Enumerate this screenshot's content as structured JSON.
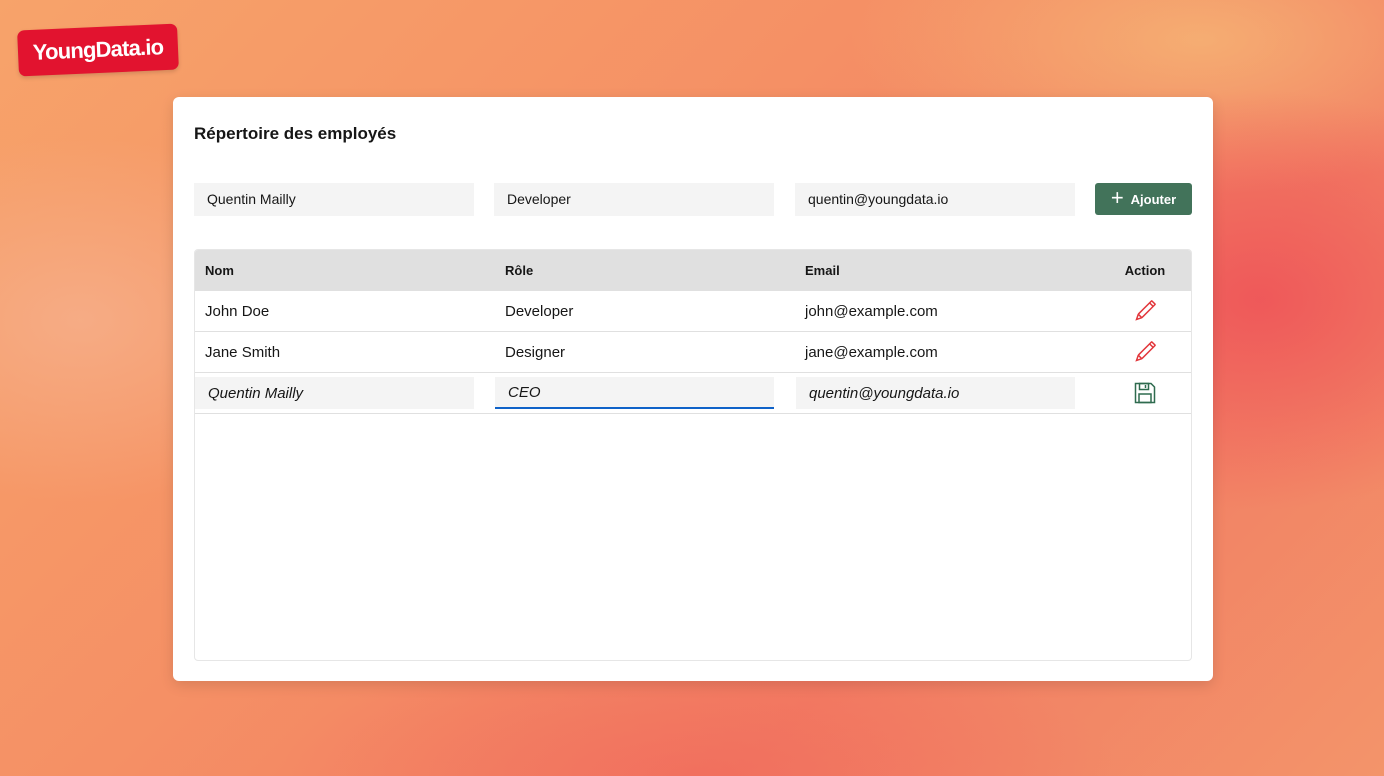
{
  "brand": {
    "logo_text": "YoungData.io",
    "color": "#e2132f"
  },
  "card": {
    "title": "Répertoire des employés"
  },
  "form": {
    "name_value": "Quentin Mailly",
    "role_value": "Developer",
    "email_value": "quentin@youngdata.io",
    "add_label": "Ajouter",
    "add_color": "#42735a"
  },
  "table": {
    "headers": {
      "name": "Nom",
      "role": "Rôle",
      "email": "Email",
      "action": "Action"
    },
    "rows": [
      {
        "name": "John Doe",
        "role": "Developer",
        "email": "john@example.com",
        "action_icon": "pencil-icon"
      },
      {
        "name": "Jane Smith",
        "role": "Designer",
        "email": "jane@example.com",
        "action_icon": "pencil-icon"
      }
    ],
    "editing_row": {
      "name": "Quentin Mailly",
      "role": "CEO",
      "email": "quentin@youngdata.io",
      "action_icon": "save-icon"
    }
  }
}
